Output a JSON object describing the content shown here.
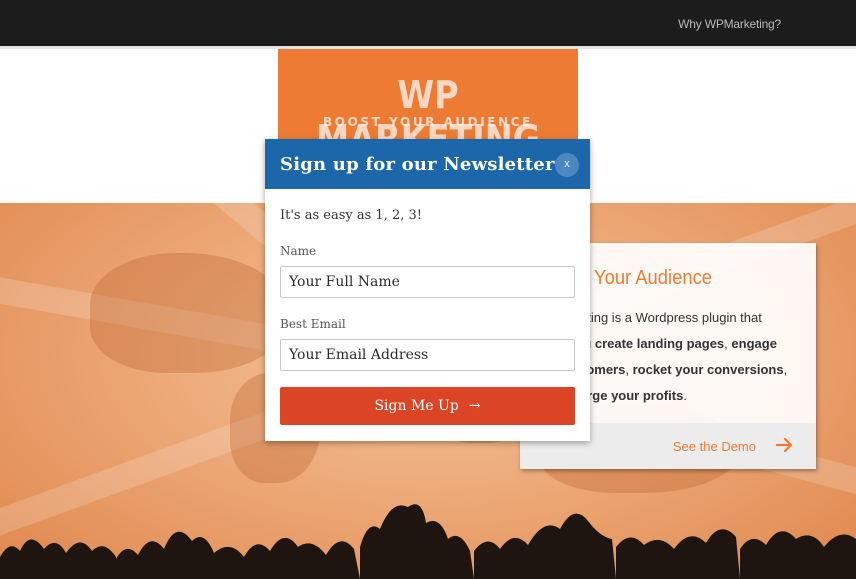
{
  "nav": {
    "why_link": "Why WPMarketing?"
  },
  "logo": {
    "title": "WP MARKETING",
    "tagline": "BOOST YOUR AUDIENCE"
  },
  "card": {
    "heading": "Your Audience",
    "line1": "eting is a Wordpress plugin that",
    "line2_pre": "u ",
    "line2_bold1": "create landing pages",
    "line2_mid": ", ",
    "line2_bold2": "engage",
    "line3_bold1": "tomers",
    "line3_mid": ", ",
    "line3_bold2": "rocket your conversions",
    "line3_end": ",",
    "line4_bold": "arge your profits",
    "line4_end": ".",
    "demo_link": "See the Demo"
  },
  "modal": {
    "title": "Sign up for our Newsletter",
    "close_label": "x",
    "intro": "It's as easy as 1, 2, 3!",
    "name_label": "Name",
    "name_placeholder": "Your Full Name",
    "email_label": "Best Email",
    "email_placeholder": "Your Email Address",
    "submit_label": "Sign Me Up",
    "submit_arrow": "→"
  },
  "colors": {
    "accent": "#ee7b33",
    "modal_header": "#1b67a9",
    "submit": "#dc4426",
    "topbar": "#1c1c1c"
  }
}
